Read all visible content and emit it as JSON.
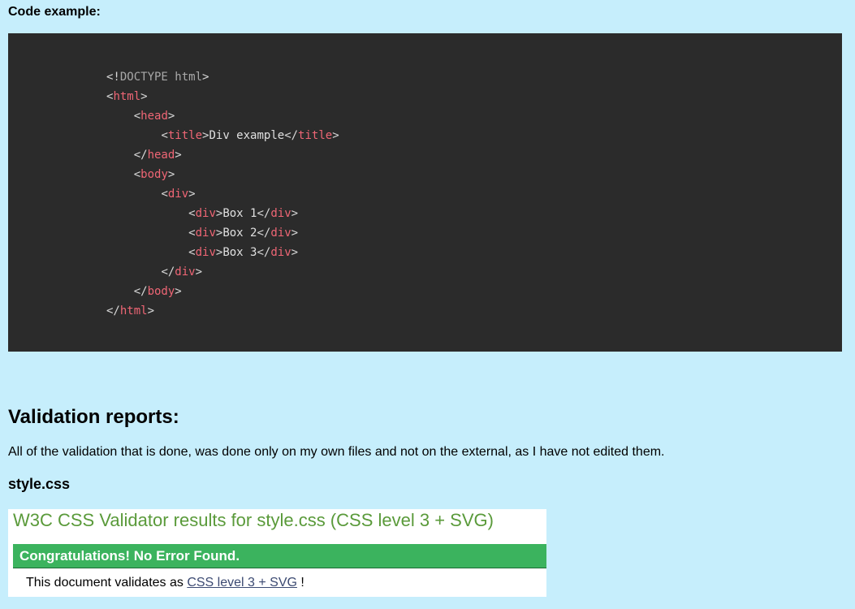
{
  "code_section": {
    "heading": "Code example:",
    "lines": [
      [
        {
          "c": "punct",
          "t": "<!"
        },
        {
          "c": "doctype",
          "t": "DOCTYPE html"
        },
        {
          "c": "punct",
          "t": ">"
        }
      ],
      [
        {
          "c": "punct",
          "t": "<"
        },
        {
          "c": "tag",
          "t": "html"
        },
        {
          "c": "punct",
          "t": ">"
        }
      ],
      [
        {
          "c": "text",
          "t": "    "
        },
        {
          "c": "punct",
          "t": "<"
        },
        {
          "c": "tag",
          "t": "head"
        },
        {
          "c": "punct",
          "t": ">"
        }
      ],
      [
        {
          "c": "text",
          "t": "        "
        },
        {
          "c": "punct",
          "t": "<"
        },
        {
          "c": "tag",
          "t": "title"
        },
        {
          "c": "punct",
          "t": ">"
        },
        {
          "c": "text",
          "t": "Div example"
        },
        {
          "c": "punct",
          "t": "</"
        },
        {
          "c": "tag",
          "t": "title"
        },
        {
          "c": "punct",
          "t": ">"
        }
      ],
      [
        {
          "c": "text",
          "t": "    "
        },
        {
          "c": "punct",
          "t": "</"
        },
        {
          "c": "tag",
          "t": "head"
        },
        {
          "c": "punct",
          "t": ">"
        }
      ],
      [
        {
          "c": "text",
          "t": "    "
        },
        {
          "c": "punct",
          "t": "<"
        },
        {
          "c": "tag",
          "t": "body"
        },
        {
          "c": "punct",
          "t": ">"
        }
      ],
      [
        {
          "c": "text",
          "t": "        "
        },
        {
          "c": "punct",
          "t": "<"
        },
        {
          "c": "tag",
          "t": "div"
        },
        {
          "c": "punct",
          "t": ">"
        }
      ],
      [
        {
          "c": "text",
          "t": "            "
        },
        {
          "c": "punct",
          "t": "<"
        },
        {
          "c": "tag",
          "t": "div"
        },
        {
          "c": "punct",
          "t": ">"
        },
        {
          "c": "text",
          "t": "Box 1"
        },
        {
          "c": "punct",
          "t": "</"
        },
        {
          "c": "tag",
          "t": "div"
        },
        {
          "c": "punct",
          "t": ">"
        }
      ],
      [
        {
          "c": "text",
          "t": "            "
        },
        {
          "c": "punct",
          "t": "<"
        },
        {
          "c": "tag",
          "t": "div"
        },
        {
          "c": "punct",
          "t": ">"
        },
        {
          "c": "text",
          "t": "Box 2"
        },
        {
          "c": "punct",
          "t": "</"
        },
        {
          "c": "tag",
          "t": "div"
        },
        {
          "c": "punct",
          "t": ">"
        }
      ],
      [
        {
          "c": "text",
          "t": "            "
        },
        {
          "c": "punct",
          "t": "<"
        },
        {
          "c": "tag",
          "t": "div"
        },
        {
          "c": "punct",
          "t": ">"
        },
        {
          "c": "text",
          "t": "Box 3"
        },
        {
          "c": "punct",
          "t": "</"
        },
        {
          "c": "tag",
          "t": "div"
        },
        {
          "c": "punct",
          "t": ">"
        }
      ],
      [
        {
          "c": "text",
          "t": "        "
        },
        {
          "c": "punct",
          "t": "</"
        },
        {
          "c": "tag",
          "t": "div"
        },
        {
          "c": "punct",
          "t": ">"
        }
      ],
      [
        {
          "c": "text",
          "t": "    "
        },
        {
          "c": "punct",
          "t": "</"
        },
        {
          "c": "tag",
          "t": "body"
        },
        {
          "c": "punct",
          "t": ">"
        }
      ],
      [
        {
          "c": "punct",
          "t": "</"
        },
        {
          "c": "tag",
          "t": "html"
        },
        {
          "c": "punct",
          "t": ">"
        }
      ]
    ]
  },
  "validation": {
    "title": "Validation reports:",
    "intro": "All of the validation that is done, was done only on my own files and not on the external, as I have not edited them.",
    "file_name": "style.css",
    "validator": {
      "title": "W3C CSS Validator results for style.css (CSS level 3 + SVG)",
      "congrats": "Congratulations! No Error Found.",
      "validates_prefix": "This document validates as ",
      "validates_link": "CSS level 3 + SVG",
      "validates_suffix": " !"
    }
  },
  "colors": {
    "page_background": "#c6eefc",
    "code_background": "#2b2b2b",
    "tag_color": "#ef6675",
    "validator_title_color": "#5a9a3a",
    "congrats_bar_color": "#3bb35e"
  }
}
